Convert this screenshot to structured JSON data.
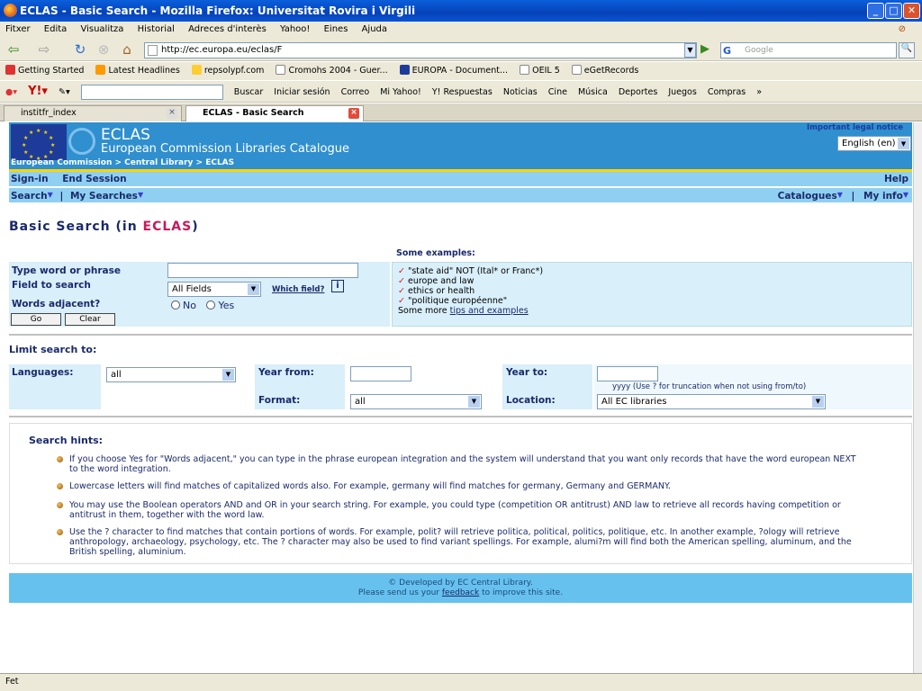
{
  "window": {
    "title": "ECLAS - Basic Search - Mozilla Firefox: Universitat Rovira i Virgili",
    "minimize": "_",
    "maximize": "□",
    "close": "✕"
  },
  "menu": [
    "Fitxer",
    "Edita",
    "Visualitza",
    "Historial",
    "Adreces d'interès",
    "Yahoo!",
    "Eines",
    "Ajuda"
  ],
  "address": {
    "url": "http://ec.europa.eu/eclas/F",
    "search_placeholder": "Google",
    "search_engine": "G"
  },
  "bookmarks": [
    "Getting Started",
    "Latest Headlines",
    "repsolypf.com",
    "Cromohs 2004 - Guer...",
    "EUROPA - Document...",
    "OEIL 5",
    "eGetRecords"
  ],
  "yahoo_toolbar": {
    "search_button": "Buscar",
    "items": [
      "Iniciar sesión",
      "Correo",
      "Mi Yahoo!",
      "Y! Respuestas",
      "Noticias",
      "Cine",
      "Música",
      "Deportes",
      "Juegos",
      "Compras"
    ],
    "overflow": "»"
  },
  "tabs": [
    {
      "label": "institfr_index",
      "active": false
    },
    {
      "label": "ECLAS - Basic Search",
      "active": true
    }
  ],
  "status": "Fet",
  "site": {
    "name": "ECLAS",
    "subtitle": "European Commission Libraries Catalogue",
    "breadcrumb": "European Commission > Central Library > ECLAS",
    "legal_notice": "Important legal notice",
    "language": "English (en)",
    "nav1": {
      "signin": "Sign-in",
      "end_session": "End Session",
      "help": "Help"
    },
    "nav2": {
      "search": "Search",
      "my_searches": "My Searches",
      "catalogues": "Catalogues",
      "my_info": "My info",
      "sep": "|"
    }
  },
  "page": {
    "title_prefix": "Basic Search (in ",
    "title_highlight": "ECLAS",
    "title_suffix": ")"
  },
  "form": {
    "word_label": "Type word or phrase",
    "word_value": "",
    "field_label": "Field to search",
    "field_value": "All Fields",
    "which_field": "Which field?",
    "info_icon": "i",
    "adjacent_label": "Words adjacent?",
    "no_label": "No",
    "yes_label": "Yes",
    "go": "Go",
    "clear": "Clear"
  },
  "examples": {
    "title": "Some examples:",
    "items": [
      "\"state aid\" NOT (Ital* or Franc*)",
      "europe and law",
      "ethics or health",
      "\"politique européenne\""
    ],
    "more_prefix": "Some more ",
    "more_link": "tips and examples"
  },
  "limit": {
    "title": "Limit search to:",
    "languages_label": "Languages:",
    "languages_value": "all",
    "year_from_label": "Year from:",
    "year_from_value": "",
    "year_to_label": "Year to:",
    "year_to_value": "",
    "year_hint": "yyyy (Use ? for truncation when not using from/to)",
    "format_label": "Format:",
    "format_value": "all",
    "location_label": "Location:",
    "location_value": "All EC libraries"
  },
  "hints": {
    "title": "Search hints:",
    "items": [
      "If you choose Yes for \"Words adjacent,\" you can type in the phrase european integration and the system will understand that you want only records that have the word european NEXT to the word integration.",
      "Lowercase letters will find matches of capitalized words also. For example, germany will find matches for germany, Germany and GERMANY.",
      "You may use the Boolean operators AND and OR in your search string. For example, you could type (competition OR antitrust) AND law to retrieve all records having competition or antitrust in them, together with the word law.",
      "Use the ? character to find matches that contain portions of words. For example, polit? will retrieve politica, political, politics, politique, etc. In another example, ?ology will retrieve anthropology, archaeology, psychology, etc. The ? character may also be used to find variant spellings. For example, alumi?m will find both the American spelling, aluminum, and the British spelling, aluminium."
    ]
  },
  "footer": {
    "line1": "© Developed by EC Central Library.",
    "line2_prefix": "Please send us your ",
    "line2_link": "feedback",
    "line2_suffix": " to improve this site."
  },
  "colors": {
    "banner": "#2f8fcf",
    "nav": "#8fd0f2",
    "form_bg": "#d9effa",
    "accent_red": "#c8195a",
    "footer": "#67c1ee"
  }
}
